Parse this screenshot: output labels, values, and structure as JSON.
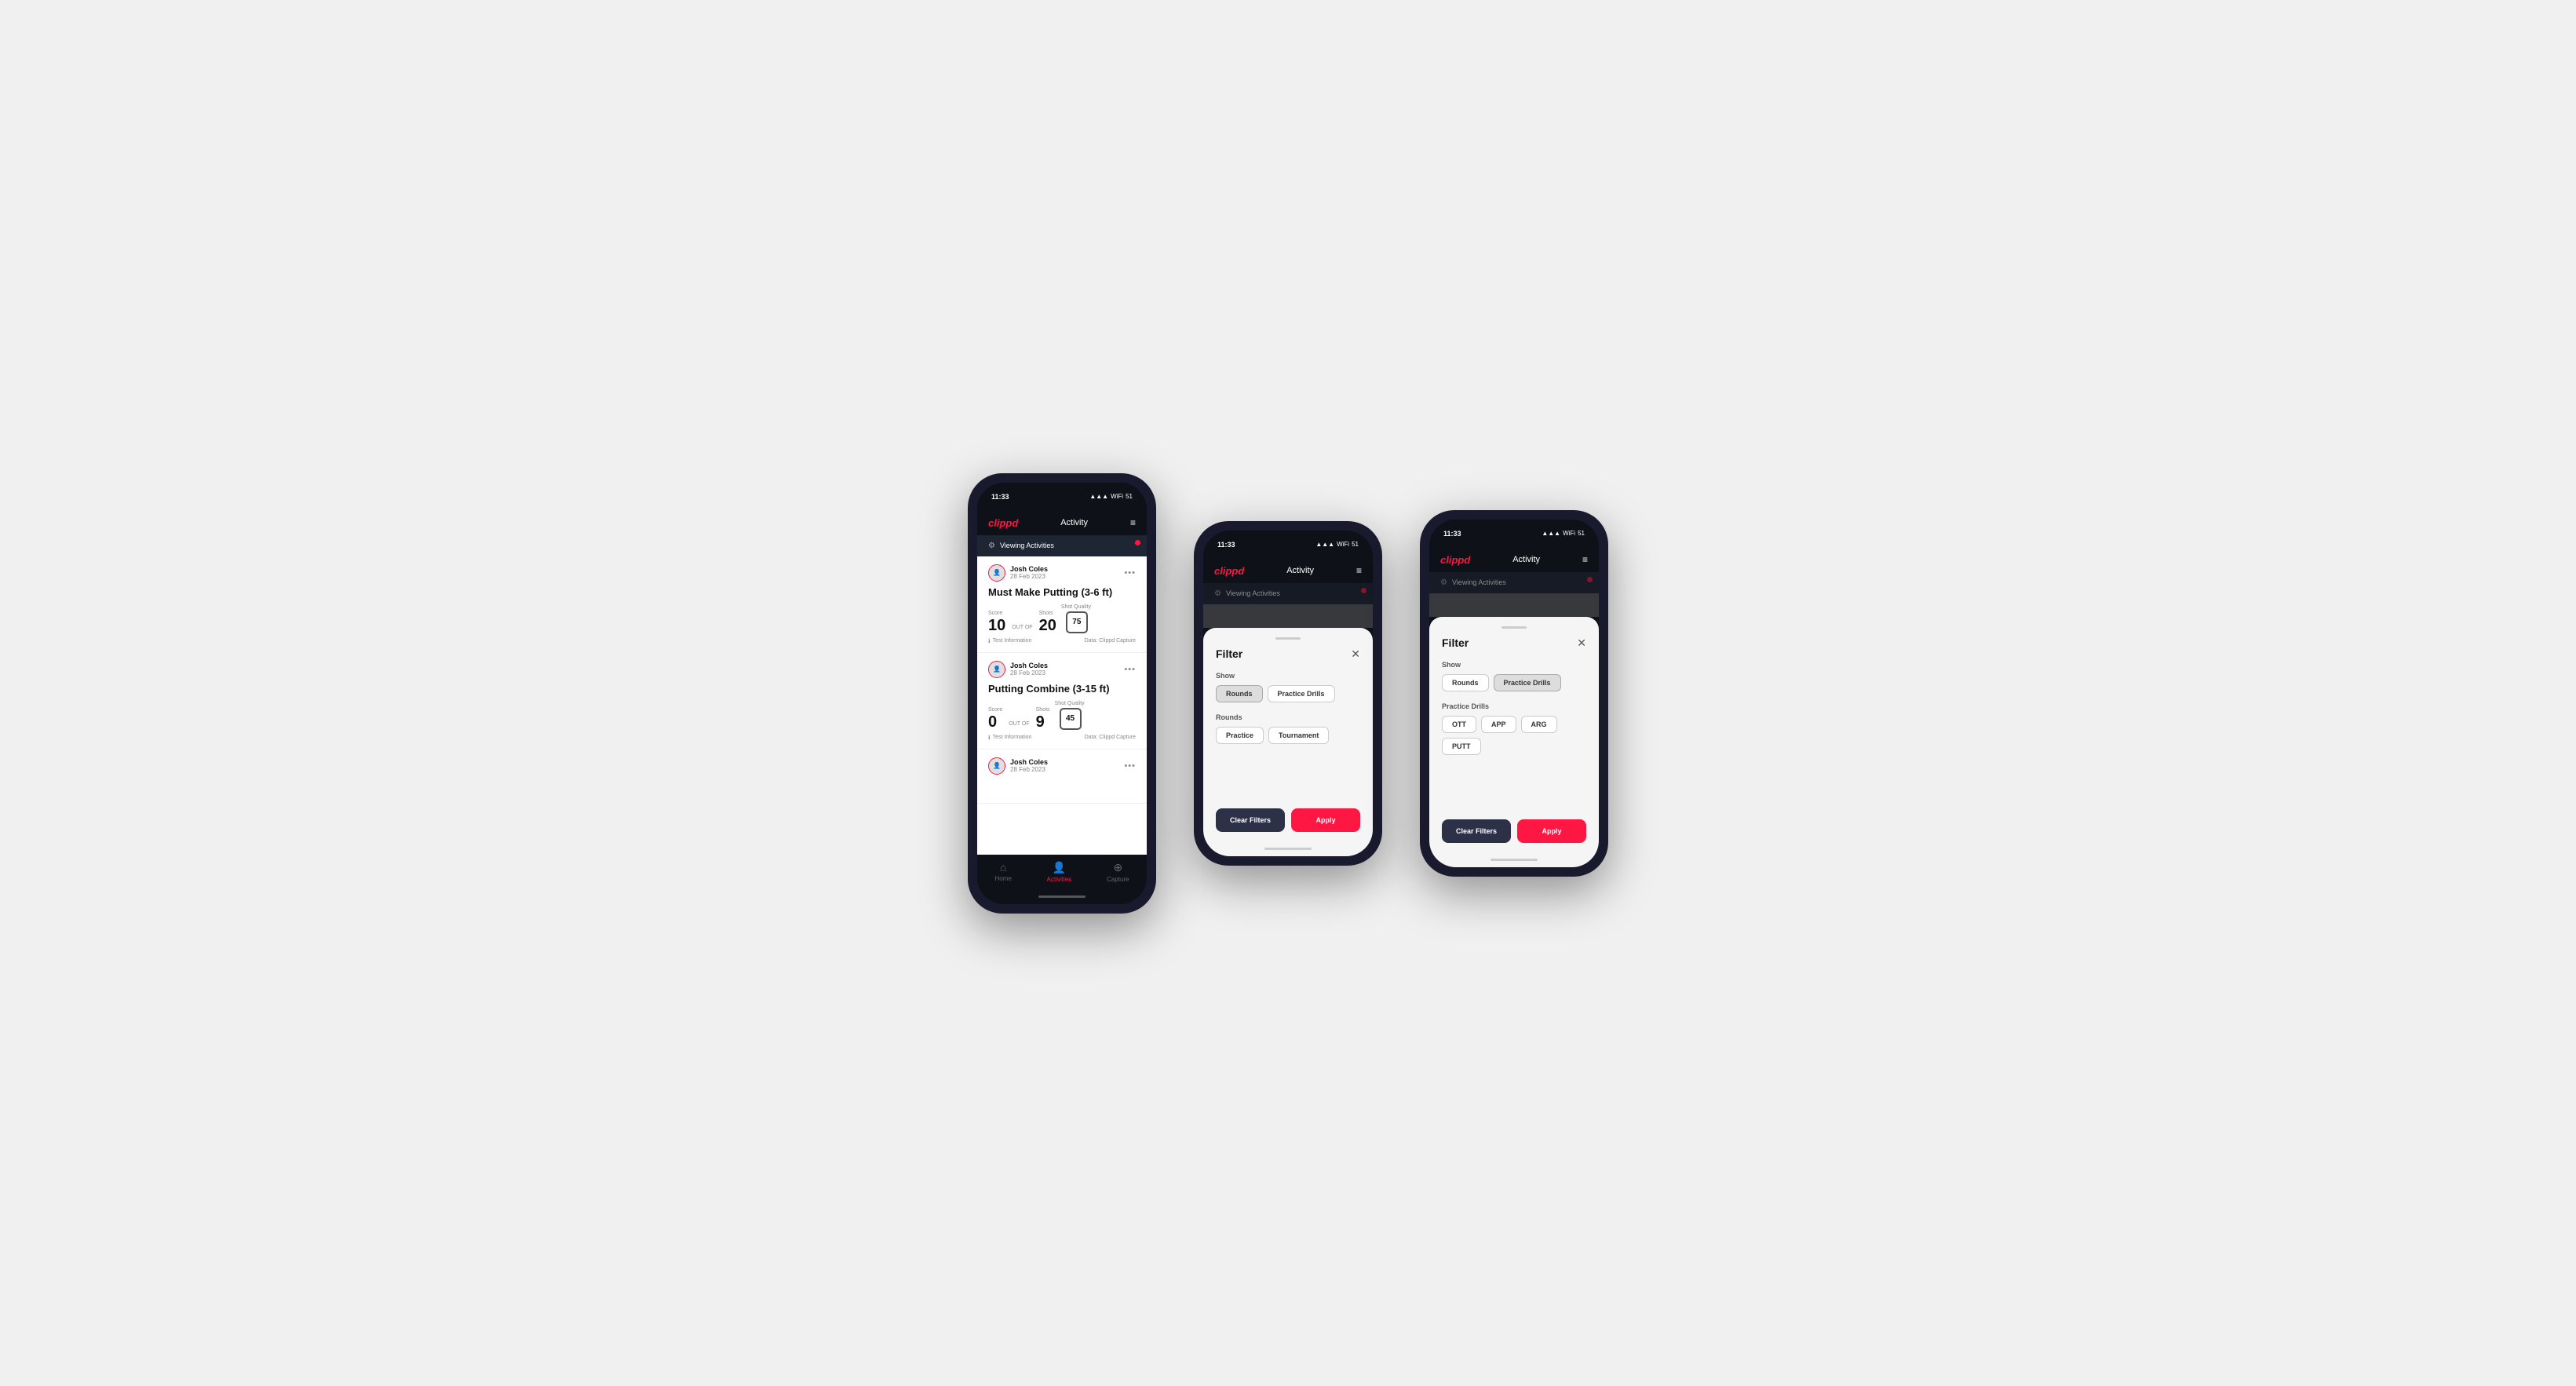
{
  "app": {
    "logo": "clippd",
    "title": "Activity",
    "status_time": "11:33",
    "status_signal": "▲▲▲",
    "status_wifi": "WiFi",
    "status_battery": "51"
  },
  "viewing_bar": {
    "text": "Viewing Activities",
    "icon": "⚙"
  },
  "phone1": {
    "cards": [
      {
        "user_name": "Josh Coles",
        "user_date": "28 Feb 2023",
        "title": "Must Make Putting (3-6 ft)",
        "score_label": "Score",
        "score_value": "10",
        "out_of_label": "OUT OF",
        "shots_label": "Shots",
        "shots_value": "20",
        "shot_quality_label": "Shot Quality",
        "shot_quality_value": "75",
        "footer_left": "Test Information",
        "footer_right": "Data: Clippd Capture"
      },
      {
        "user_name": "Josh Coles",
        "user_date": "28 Feb 2023",
        "title": "Putting Combine (3-15 ft)",
        "score_label": "Score",
        "score_value": "0",
        "out_of_label": "OUT OF",
        "shots_label": "Shots",
        "shots_value": "9",
        "shot_quality_label": "Shot Quality",
        "shot_quality_value": "45",
        "footer_left": "Test Information",
        "footer_right": "Data: Clippd Capture"
      }
    ],
    "nav": {
      "home_label": "Home",
      "activities_label": "Activities",
      "capture_label": "Capture"
    }
  },
  "phone2": {
    "filter": {
      "title": "Filter",
      "show_label": "Show",
      "rounds_chip": "Rounds",
      "practice_drills_chip": "Practice Drills",
      "rounds_section_label": "Rounds",
      "practice_chip": "Practice",
      "tournament_chip": "Tournament",
      "clear_label": "Clear Filters",
      "apply_label": "Apply"
    }
  },
  "phone3": {
    "filter": {
      "title": "Filter",
      "show_label": "Show",
      "rounds_chip": "Rounds",
      "practice_drills_chip": "Practice Drills",
      "practice_drills_section_label": "Practice Drills",
      "ott_chip": "OTT",
      "app_chip": "APP",
      "arg_chip": "ARG",
      "putt_chip": "PUTT",
      "clear_label": "Clear Filters",
      "apply_label": "Apply"
    }
  }
}
